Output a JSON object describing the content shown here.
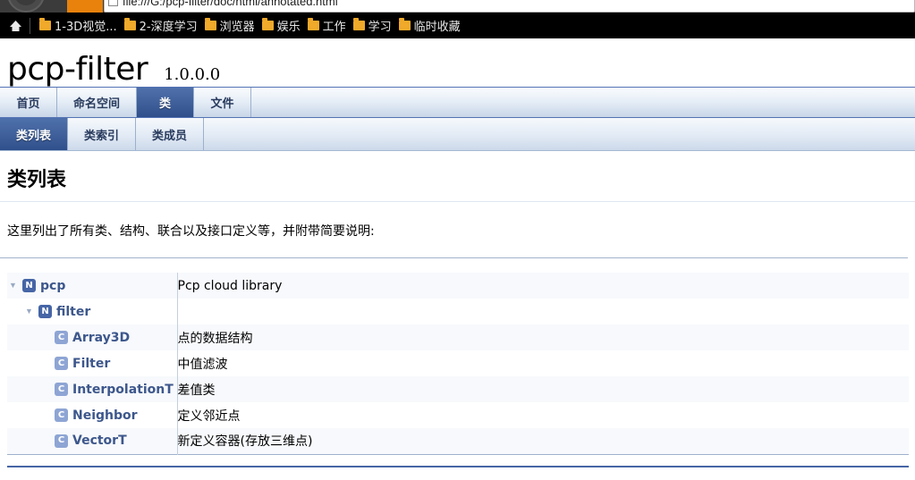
{
  "browser": {
    "url": "file:///G:/pcp-filter/doc/html/annotated.html",
    "home_icon": "home-icon",
    "bookmarks": [
      {
        "label": "1-3D视觉...",
        "icon": "folder-icon"
      },
      {
        "label": "2-深度学习",
        "icon": "folder-icon"
      },
      {
        "label": "浏览器",
        "icon": "folder-icon"
      },
      {
        "label": "娱乐",
        "icon": "folder-icon"
      },
      {
        "label": "工作",
        "icon": "folder-icon"
      },
      {
        "label": "学习",
        "icon": "folder-icon"
      },
      {
        "label": "临时收藏",
        "icon": "folder-icon"
      }
    ]
  },
  "project": {
    "name": "pcp-filter",
    "version": "1.0.0.0"
  },
  "tabs_main": [
    {
      "label": "首页",
      "active": false
    },
    {
      "label": "命名空间",
      "active": false
    },
    {
      "label": "类",
      "active": true
    },
    {
      "label": "文件",
      "active": false
    }
  ],
  "tabs_sub": [
    {
      "label": "类列表",
      "active": true
    },
    {
      "label": "类索引",
      "active": false
    },
    {
      "label": "类成员",
      "active": false
    }
  ],
  "page": {
    "title": "类列表",
    "description": "这里列出了所有类、结构、联合以及接口定义等，并附带简要说明:"
  },
  "directory": {
    "rows": [
      {
        "arrow": "▼",
        "icon": "N",
        "icon_kind": "ns",
        "indent": 0,
        "name": "pcp",
        "desc": "Pcp cloud library"
      },
      {
        "arrow": "▼",
        "icon": "N",
        "icon_kind": "ns",
        "indent": 1,
        "name": "filter",
        "desc": ""
      },
      {
        "arrow": "",
        "icon": "C",
        "icon_kind": "cls",
        "indent": 2,
        "name": "Array3D",
        "desc": "点的数据结构"
      },
      {
        "arrow": "",
        "icon": "C",
        "icon_kind": "cls",
        "indent": 2,
        "name": "Filter",
        "desc": "中值滤波"
      },
      {
        "arrow": "",
        "icon": "C",
        "icon_kind": "cls",
        "indent": 2,
        "name": "InterpolationT",
        "desc": "差值类"
      },
      {
        "arrow": "",
        "icon": "C",
        "icon_kind": "cls",
        "indent": 2,
        "name": "Neighbor",
        "desc": "定义邻近点"
      },
      {
        "arrow": "",
        "icon": "C",
        "icon_kind": "cls",
        "indent": 2,
        "name": "VectorT",
        "desc": "新定义容器(存放三维点)"
      }
    ]
  },
  "colors": {
    "accent": "#3d578c",
    "tab_active": "#30508c",
    "namespace_icon": "#4665a6",
    "class_icon": "#8ea5d4",
    "bookmark_folder": "#f0a92a"
  }
}
